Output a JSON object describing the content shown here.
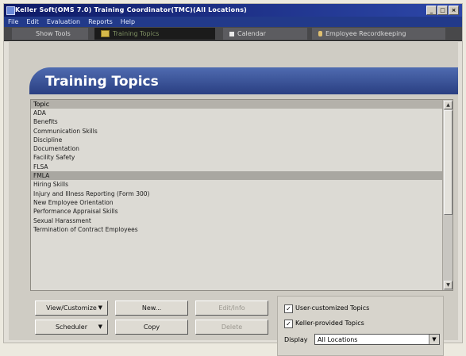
{
  "window": {
    "title": "Keller Soft(OMS 7.0) Training Coordinator(TMC)(All Locations)"
  },
  "menu": [
    "File",
    "Edit",
    "Evaluation",
    "Reports",
    "Help"
  ],
  "toolbar": {
    "items": [
      {
        "label": "Show Tools",
        "icon": "tools-icon"
      },
      {
        "label": "Training Topics",
        "icon": "folder-icon"
      },
      {
        "label": "Calendar",
        "icon": "calendar-icon"
      },
      {
        "label": "Employee Recordkeeping",
        "icon": "person-icon"
      }
    ]
  },
  "banner": {
    "title": "Training Topics"
  },
  "list": {
    "header": "Topic",
    "items": [
      "ADA",
      "Benefits",
      "Communication Skills",
      "Discipline",
      "Documentation",
      "Facility Safety",
      "FLSA",
      "FMLA",
      "Hiring Skills",
      "Injury and Illness Reporting (Form 300)",
      "New Employee Orientation",
      "Performance Appraisal Skills",
      "Sexual Harassment",
      "Termination of Contract Employees"
    ],
    "selected_index": 7
  },
  "buttons": {
    "view_customize": "View/Customize",
    "scheduler": "Scheduler",
    "new": "New...",
    "copy": "Copy",
    "edit": "Edit/Info",
    "delete": "Delete"
  },
  "options": {
    "user_customized": "User-customized Topics",
    "keller_provided": "Keller-provided Topics",
    "display_label": "Display",
    "display_value": "All Locations"
  },
  "colors": {
    "title_bar": "#0e1a66",
    "menu_bar": "#223a8a",
    "banner": "#3c58a0",
    "selected_row": "#a9a7a1"
  }
}
